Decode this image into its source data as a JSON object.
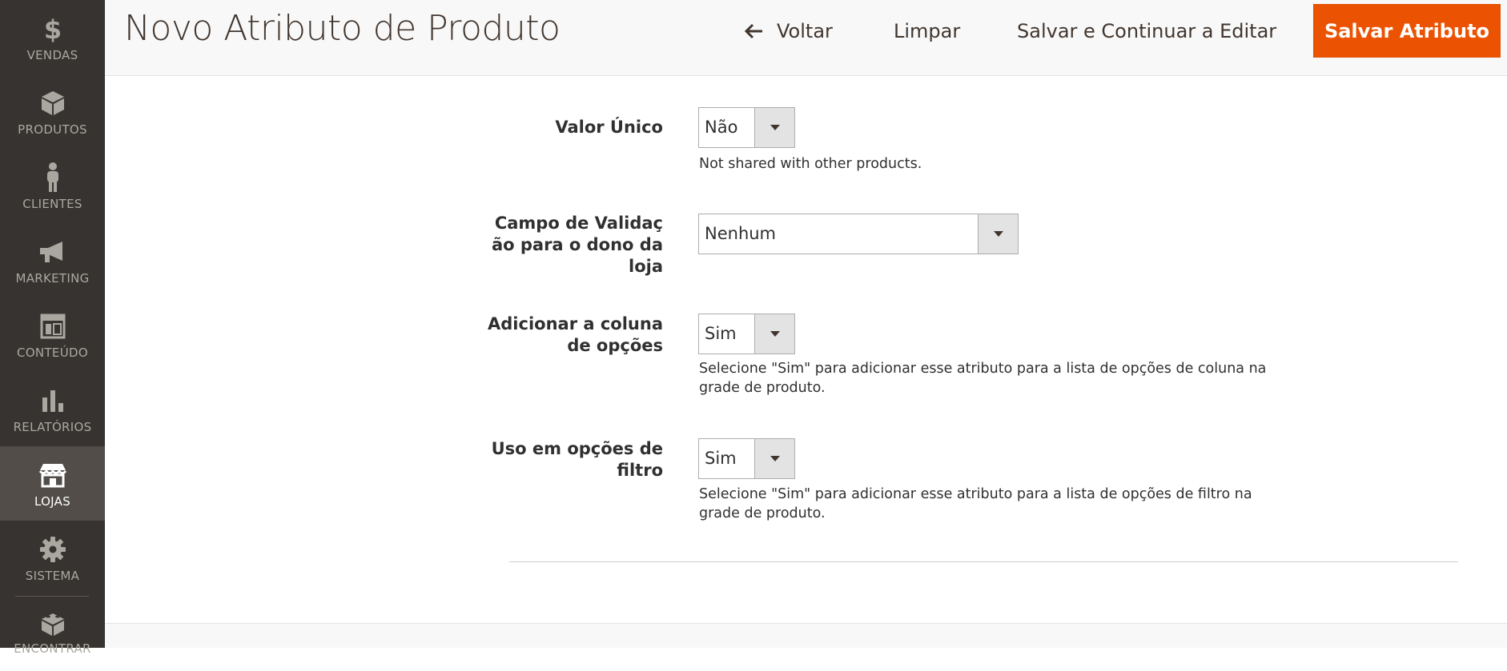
{
  "sidebar": {
    "items": [
      {
        "label": "VENDAS",
        "icon": "dollar-icon"
      },
      {
        "label": "PRODUTOS",
        "icon": "box-icon"
      },
      {
        "label": "CLIENTES",
        "icon": "person-icon"
      },
      {
        "label": "MARKETING",
        "icon": "megaphone-icon"
      },
      {
        "label": "CONTEÚDO",
        "icon": "layout-icon"
      },
      {
        "label": "RELATÓRIOS",
        "icon": "bar-chart-icon"
      },
      {
        "label": "LOJAS",
        "icon": "store-icon",
        "active": true
      },
      {
        "label": "SISTEMA",
        "icon": "gear-icon"
      },
      {
        "label": "ENCONTRAR",
        "icon": "blocks-icon"
      }
    ]
  },
  "header": {
    "title": "Novo Atributo de Produto",
    "back_label": "Voltar",
    "clear_label": "Limpar",
    "save_continue_label": "Salvar e Continuar a Editar",
    "save_label": "Salvar Atributo"
  },
  "form": {
    "unique_value": {
      "label": "Valor Único",
      "value": "Não",
      "note": "Not shared with other products."
    },
    "validation": {
      "label_lines": [
        "Campo de Validaç",
        "ão para o dono da",
        "loja"
      ],
      "value": "Nenhum"
    },
    "options_column": {
      "label_lines": [
        "Adicionar a coluna",
        "de opções"
      ],
      "value": "Sim",
      "note": "Selecione \"Sim\" para adicionar esse atributo para a lista de opções de coluna na grade de produto."
    },
    "filter_options": {
      "label_lines": [
        "Uso em opções de",
        "filtro"
      ],
      "value": "Sim",
      "note": "Selecione \"Sim\" para adicionar esse atributo para a lista de opções de filtro na grade de produto."
    }
  },
  "colors": {
    "sidebar_bg": "#373330",
    "sidebar_active": "#524d49",
    "primary_button": "#eb5202"
  }
}
